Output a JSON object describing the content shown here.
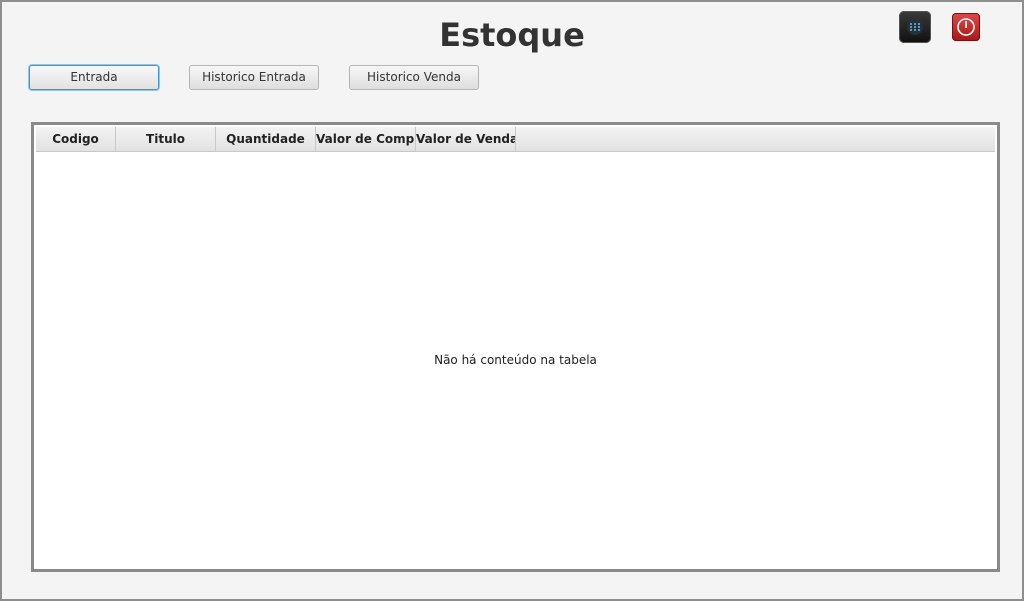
{
  "window": {
    "title": "Estoque"
  },
  "toolbar": {
    "entrada_label": "Entrada",
    "historico_entrada_label": "Historico Entrada",
    "historico_venda_label": "Historico Venda"
  },
  "icons": {
    "menu": "apps-grid-icon",
    "power": "power-icon"
  },
  "table": {
    "columns": [
      "Codigo",
      "Titulo",
      "Quantidade",
      "Valor de Compra",
      "Valor de Venda"
    ],
    "rows": [],
    "placeholder": "Não há conteúdo na tabela"
  },
  "colors": {
    "focus_border": "#3a9ad8",
    "power_red": "#c02020",
    "menu_dark": "#1e1e1e"
  }
}
